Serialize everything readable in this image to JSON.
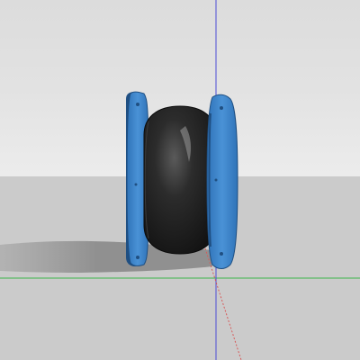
{
  "viewport": {
    "sky_color": "#e4e4e4",
    "ground_color": "#cbcbcb"
  },
  "model": {
    "name": "",
    "body_color": "#1e1e1e",
    "flange_color": "#3f86c9",
    "flange_edge_color": "#1f4f82",
    "shadow_color": "#8f8f8f"
  },
  "axes": {
    "green_axis_color": "#3bb54a",
    "blue_axis_color": "#4b4bd6",
    "red_axis_color": "#d65a5a"
  }
}
